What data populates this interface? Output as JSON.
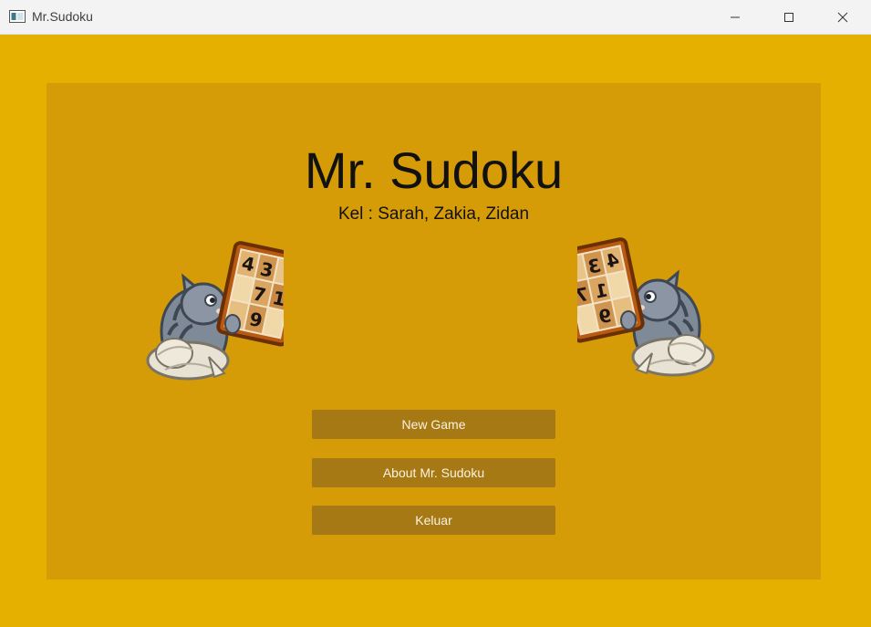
{
  "window": {
    "title": "Mr.Sudoku",
    "icons": {
      "app": "window-app-icon",
      "minimize": "minimize-icon",
      "maximize": "maximize-icon",
      "close": "close-icon"
    }
  },
  "colors": {
    "background": "#e6b000",
    "panel": "#d59c07",
    "button": "#a67914",
    "button_text": "#fbf3e0"
  },
  "main": {
    "title": "Mr. Sudoku",
    "subtitle": "Kel : Sarah, Zakia, Zidan",
    "mascot_left_tiles": [
      "4",
      "3",
      "7",
      "1",
      "9"
    ],
    "mascot_right_tiles": [
      "4",
      "3",
      "1",
      "7",
      "9"
    ]
  },
  "menu": {
    "new_game": "New Game",
    "about": "About Mr. Sudoku",
    "exit": "Keluar"
  }
}
